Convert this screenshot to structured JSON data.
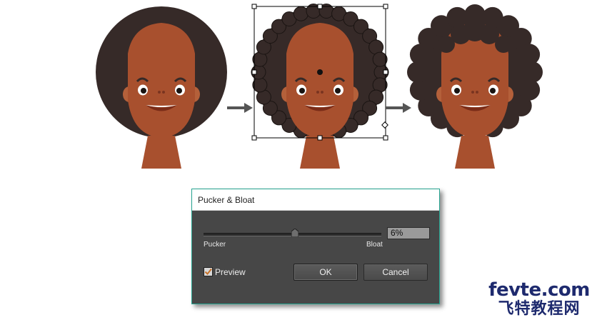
{
  "dialog": {
    "title": "Pucker & Bloat",
    "slider": {
      "min_label": "Pucker",
      "max_label": "Bloat",
      "value": 6
    },
    "value_text": "6%",
    "preview": {
      "label": "Preview",
      "checked": true
    },
    "ok_label": "OK",
    "cancel_label": "Cancel"
  },
  "illustration": {
    "stages": [
      "original",
      "transforming",
      "result"
    ],
    "colors": {
      "hair": "#362a28",
      "skin": "#a8502e",
      "ear": "#b4603a",
      "mouth": "#7a2c18",
      "teeth": "#ffffff",
      "selection": "#000000",
      "arrow": "#555555"
    },
    "icons": [
      "arrow-right-icon",
      "arrow-right-icon"
    ]
  },
  "brand": {
    "main": "fevte.com",
    "sub": "飞特教程网",
    "color": "#1e2a6e"
  }
}
